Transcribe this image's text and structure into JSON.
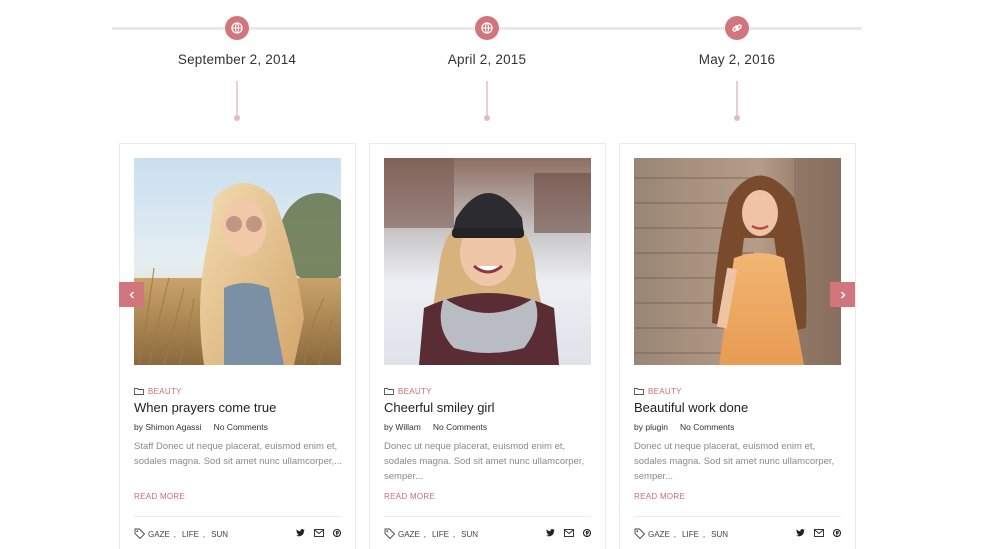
{
  "timeline": [
    {
      "date": "September 2, 2014",
      "icon": "globe-icon"
    },
    {
      "date": "April 2, 2015",
      "icon": "globe-icon"
    },
    {
      "date": "May 2, 2016",
      "icon": "link-icon"
    }
  ],
  "posts": [
    {
      "category": "BEAUTY",
      "title": "When prayers come true",
      "author": "by Shimon Agassi",
      "comments": "No Comments",
      "excerpt": "Staff Donec ut neque placerat, euismod enim et, sodales magna. Sod sit amet nunc ullamcorper,...",
      "read_more": "READ MORE",
      "tags": [
        "GAZE",
        "LIFE",
        "SUN"
      ]
    },
    {
      "category": "BEAUTY",
      "title": "Cheerful smiley girl",
      "author": "by Willam",
      "comments": "No Comments",
      "excerpt": "Donec ut neque placerat, euismod enim et, sodales magna. Sod sit amet nunc ullamcorper, semper...",
      "read_more": "READ MORE",
      "tags": [
        "GAZE",
        "LIFE",
        "SUN"
      ]
    },
    {
      "category": "BEAUTY",
      "title": "Beautiful work done",
      "author": "by plugin",
      "comments": "No Comments",
      "excerpt": "Donec ut neque placerat, euismod enim et, sodales magna. Sod sit amet nunc ullamcorper, semper...",
      "read_more": "READ MORE",
      "tags": [
        "GAZE",
        "LIFE",
        "SUN"
      ]
    }
  ],
  "carousel": {
    "prev_glyph": "‹",
    "next_glyph": "›"
  },
  "share_icons": [
    "twitter-icon",
    "email-icon",
    "pinterest-icon"
  ],
  "colors": {
    "accent": "#d0767c",
    "line": "#e9e9e9",
    "stem": "#ebcfcf"
  }
}
